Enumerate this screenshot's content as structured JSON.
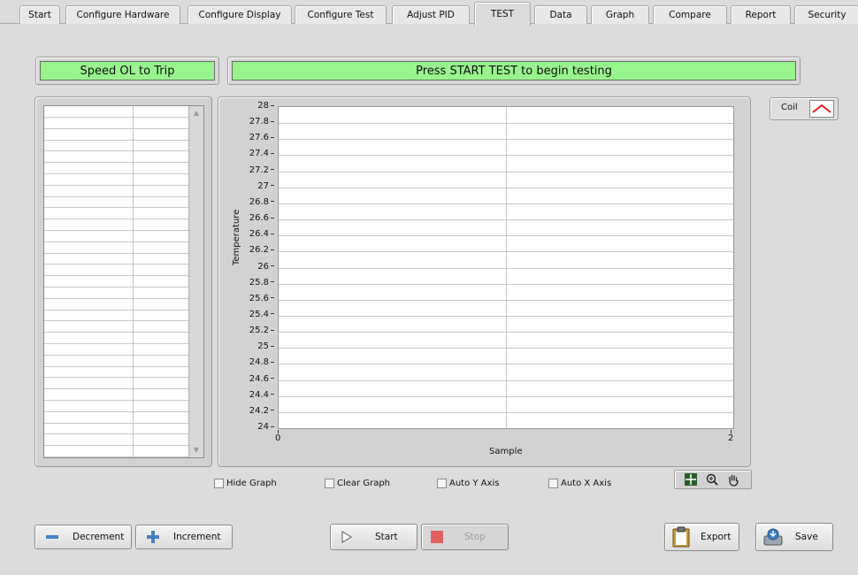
{
  "tabs": [
    {
      "label": "Start",
      "active": false
    },
    {
      "label": "Configure Hardware",
      "active": false
    },
    {
      "label": "Configure Display",
      "active": false
    },
    {
      "label": "Configure Test",
      "active": false
    },
    {
      "label": "Adjust PID",
      "active": false
    },
    {
      "label": "TEST",
      "active": true
    },
    {
      "label": "Data",
      "active": false
    },
    {
      "label": "Graph",
      "active": false
    },
    {
      "label": "Compare",
      "active": false
    },
    {
      "label": "Report",
      "active": false
    },
    {
      "label": "Security",
      "active": false
    }
  ],
  "status": {
    "mode": "Speed OL to Trip",
    "message": "Press START TEST to begin testing",
    "display_color": "#98f48d"
  },
  "graph": {
    "ylabel": "Temperature",
    "xlabel": "Sample",
    "y_ticks": [
      "28",
      "27.8",
      "27.6",
      "27.4",
      "27.2",
      "27",
      "26.8",
      "26.6",
      "26.4",
      "26.2",
      "26",
      "25.8",
      "25.6",
      "25.4",
      "25.2",
      "25",
      "24.8",
      "24.6",
      "24.4",
      "24.2",
      "24"
    ],
    "x_ticks": [
      "0",
      "2"
    ],
    "legend": {
      "label": "Coil",
      "color": "#e02020"
    }
  },
  "chart_data": {
    "type": "line",
    "xlabel": "Sample",
    "ylabel": "Temperature",
    "xlim": [
      0,
      2
    ],
    "ylim": [
      24,
      28
    ],
    "grid": true,
    "legend_placement": "top-right",
    "series": [
      {
        "name": "Coil",
        "values": []
      }
    ]
  },
  "options": {
    "hide_graph": "Hide Graph",
    "clear_graph": "Clear Graph",
    "auto_y": "Auto Y Axis",
    "auto_x": "Auto X Axis"
  },
  "buttons": {
    "decrement": "Decrement",
    "increment": "Increment",
    "start": "Start",
    "stop": "Stop",
    "export": "Export",
    "save": "Save"
  },
  "icons": {
    "decrement": "minus-icon",
    "increment": "plus-icon",
    "start": "play-icon",
    "stop": "stop-icon",
    "export": "clipboard-icon",
    "save": "save-icon",
    "tools": [
      "crosshair-icon",
      "zoom-icon",
      "pan-hand-icon"
    ]
  }
}
